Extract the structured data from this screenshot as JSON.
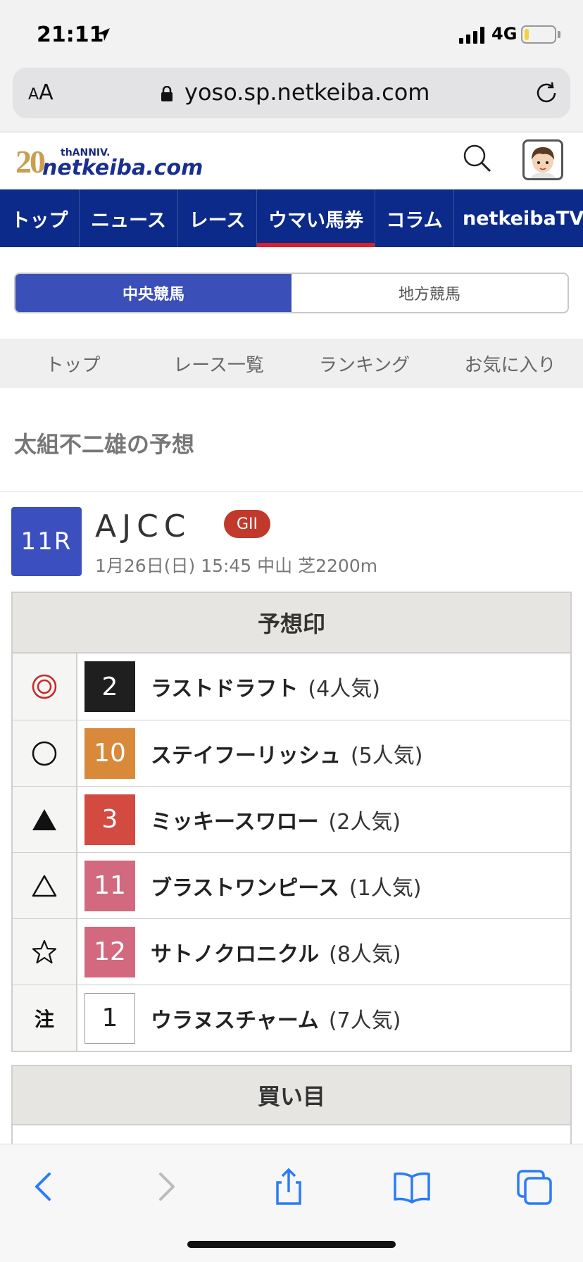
{
  "status": {
    "time": "21:11",
    "network": "4G",
    "battery_level": 0.15
  },
  "browser": {
    "aa_label": "AA",
    "url": "yoso.sp.netkeiba.com"
  },
  "site": {
    "logo_number": "20",
    "logo_anniv": "thANNIV.",
    "logo_name": "netkeiba.com"
  },
  "global_nav": [
    {
      "label": "トップ",
      "active": false
    },
    {
      "label": "ニュース",
      "active": false
    },
    {
      "label": "レース",
      "active": false
    },
    {
      "label": "ウマい馬券",
      "active": true
    },
    {
      "label": "コラム",
      "active": false
    },
    {
      "label": "netkeibaTV",
      "active": false
    }
  ],
  "segment": {
    "left": "中央競馬",
    "right": "地方競馬",
    "selected": "left"
  },
  "sub_nav": [
    "トップ",
    "レース一覧",
    "ランキング",
    "お気に入り"
  ],
  "page_title": "太組不二雄の予想",
  "race": {
    "number": "11R",
    "name": "AJCC",
    "grade": "GII",
    "info": "1月26日(日) 15:45 中山 芝2200m"
  },
  "prediction": {
    "title": "予想印",
    "rows": [
      {
        "mark_icon": "double-circle",
        "mark_text": "",
        "num": "2",
        "num_bg": "#1f1f1f",
        "num_fg": "#ffffff",
        "name": "ラストドラフト",
        "pop": "(4人気)"
      },
      {
        "mark_icon": "circle",
        "mark_text": "",
        "num": "10",
        "num_bg": "#d88a3a",
        "num_fg": "#ffffff",
        "name": "ステイフーリッシュ",
        "pop": "(5人気)"
      },
      {
        "mark_icon": "filled-triangle",
        "mark_text": "",
        "num": "3",
        "num_bg": "#d24a40",
        "num_fg": "#ffffff",
        "name": "ミッキースワロー",
        "pop": "(2人気)"
      },
      {
        "mark_icon": "triangle",
        "mark_text": "",
        "num": "11",
        "num_bg": "#d3697e",
        "num_fg": "#ffffff",
        "name": "ブラストワンピース",
        "pop": "(1人気)"
      },
      {
        "mark_icon": "star",
        "mark_text": "",
        "num": "12",
        "num_bg": "#d3697e",
        "num_fg": "#ffffff",
        "name": "サトノクロニクル",
        "pop": "(8人気)"
      },
      {
        "mark_icon": "text",
        "mark_text": "注",
        "num": "1",
        "num_bg": "#ffffff",
        "num_fg": "#222222",
        "name": "ウラヌスチャーム",
        "pop": "(7人気)"
      }
    ]
  },
  "buy": {
    "title": "買い目"
  },
  "colors": {
    "nav_bg": "#0b2a8a",
    "accent": "#3b4fbf",
    "nav_active": "#d8202a",
    "grade": "#c0392b"
  }
}
